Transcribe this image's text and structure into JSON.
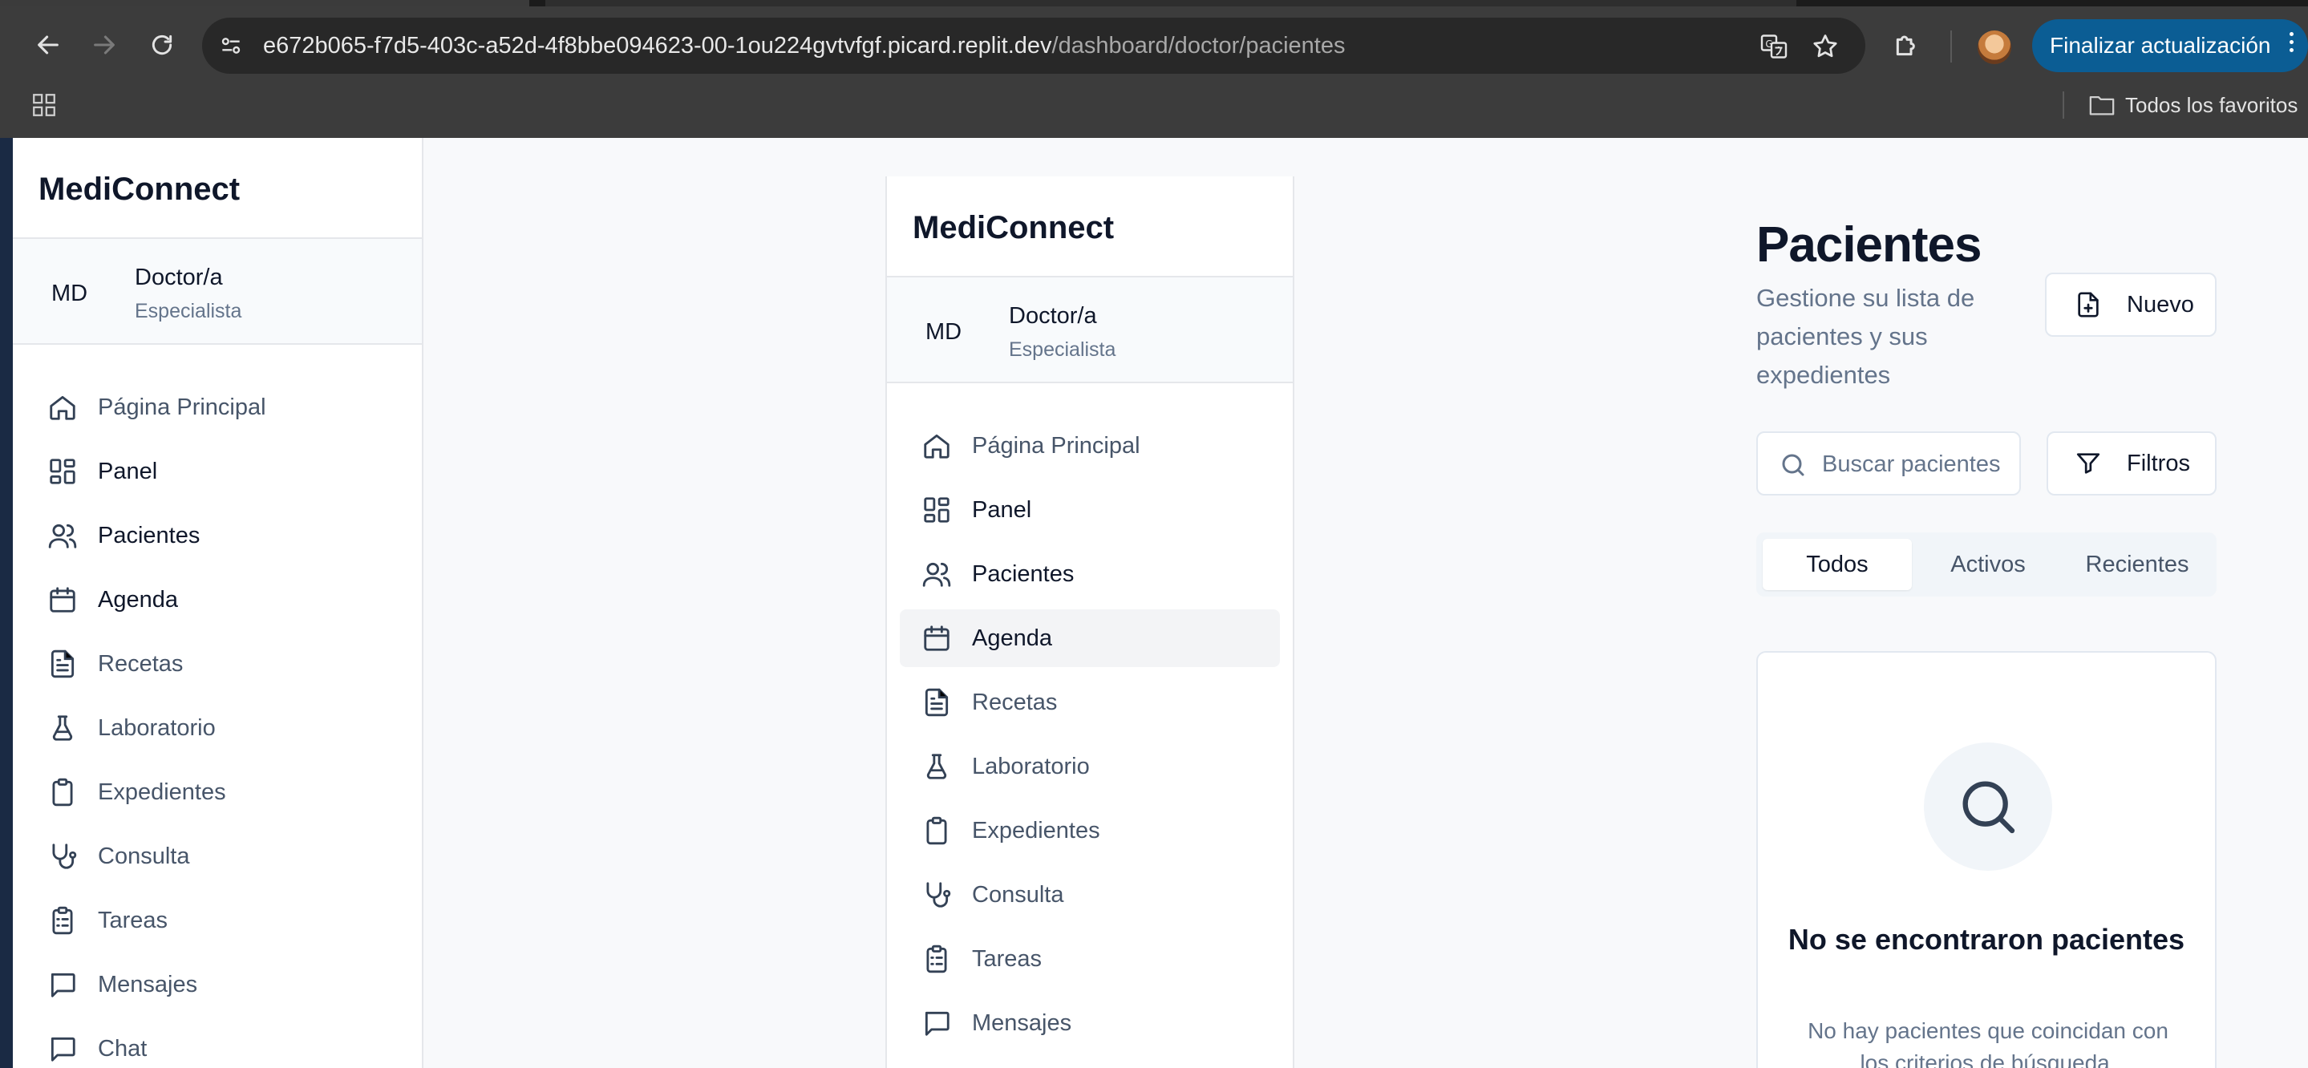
{
  "browser": {
    "url_host": "e672b065-f7d5-403c-a52d-4f8bbe094623-00-1ou224gvtvfgf.picard.replit.dev",
    "url_path": "/dashboard/doctor/pacientes",
    "update_label": "Finalizar actualización",
    "bookmarks_all": "Todos los favoritos"
  },
  "app": {
    "brand": "MediConnect",
    "user": {
      "initials": "MD",
      "name": "Doctor/a",
      "role": "Especialista"
    },
    "nav": [
      {
        "label": "Página Principal",
        "icon": "home-icon"
      },
      {
        "label": "Panel",
        "icon": "dashboard-grid-icon"
      },
      {
        "label": "Pacientes",
        "icon": "users-icon"
      },
      {
        "label": "Agenda",
        "icon": "calendar-icon"
      },
      {
        "label": "Recetas",
        "icon": "document-icon"
      },
      {
        "label": "Laboratorio",
        "icon": "flask-icon"
      },
      {
        "label": "Expedientes",
        "icon": "clipboard-icon"
      },
      {
        "label": "Consulta",
        "icon": "stethoscope-icon"
      },
      {
        "label": "Tareas",
        "icon": "checklist-icon"
      },
      {
        "label": "Mensajes",
        "icon": "message-icon"
      },
      {
        "label": "Chat",
        "icon": "chat-icon"
      }
    ]
  },
  "main": {
    "title": "Pacientes",
    "subtitle": "Gestione su lista de pacientes y sus expedientes",
    "new_label": "Nuevo",
    "search_placeholder": "Buscar pacientes",
    "filters_label": "Filtros",
    "tabs": [
      "Todos",
      "Activos",
      "Recientes"
    ],
    "active_tab": "Todos",
    "empty_title": "No se encontraron pacientes",
    "empty_desc": "No hay pacientes que coincidan con los criterios de búsqueda."
  },
  "colors": {
    "accent": "#0b5d94",
    "text": "#0f172a",
    "muted": "#64748b",
    "border": "#e2e8f0"
  }
}
